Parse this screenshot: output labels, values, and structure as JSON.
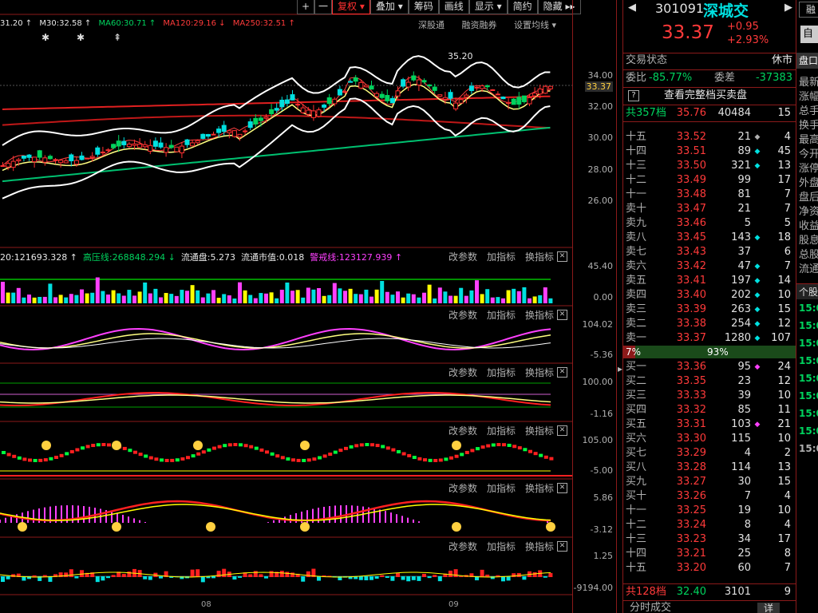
{
  "toolbar": {
    "plus": "+",
    "minus": "一",
    "items": [
      "复权",
      "叠加",
      "筹码",
      "画线",
      "显示",
      "简约",
      "隐藏"
    ],
    "arrows": [
      "▾",
      "▾",
      "",
      "",
      "▾",
      "",
      "▸▸"
    ]
  },
  "ma_row": {
    "ma_first": "31.20 ↑",
    "ma30": "M30:32.58 ↑",
    "ma60": "MA60:30.71 ↑",
    "ma120": "MA120:29.16 ↓",
    "ma250": "MA250:32.51 ↑"
  },
  "chart_links": [
    "深股通",
    "融资融券",
    "设置均线 ▾"
  ],
  "markers": [
    "✱",
    "✱",
    "⇞"
  ],
  "price_annot": "35.20",
  "price_axis": [
    "34.00",
    "33.37",
    "32.00",
    "30.00",
    "28.00",
    "26.00"
  ],
  "vol_header": {
    "a": "20:121693.328 ↑",
    "b": "高压线:268848.294 ↓",
    "c": "流通盘:5.273",
    "d": "流通市值:0.018",
    "e": "警戒线:123127.939 ↑"
  },
  "panel_buttons": [
    "改参数",
    "加指标",
    "换指标"
  ],
  "close_glyph": "✕",
  "panel_axes": [
    [
      "45.40",
      "0.00"
    ],
    [
      "104.02",
      "-5.36"
    ],
    [
      "100.00",
      "-1.16"
    ],
    [
      "105.00",
      "-5.00"
    ],
    [
      "5.86",
      "-3.12"
    ],
    [
      "1.25",
      "-9194.00"
    ]
  ],
  "x_axis": [
    "08",
    "09"
  ],
  "chart_data": {
    "type": "candlestick",
    "price_ylim": [
      26,
      36
    ],
    "current_price": 33.37,
    "high_annotation": 35.2,
    "x_ticks": [
      "08",
      "09"
    ],
    "moving_averages": {
      "M30": 32.58,
      "MA60": 30.71,
      "MA120": 29.16,
      "MA250": 32.51
    },
    "volume_indicator": {
      "高压线": 268848.294,
      "流通盘": 5.273,
      "流通市值": 0.018,
      "警戒线": 123127.939
    }
  },
  "quote": {
    "code": "301091",
    "name": "深城交",
    "price": "33.37",
    "change": "+0.95",
    "change_pct": "+2.93%",
    "btn_self": "自",
    "trade_status_label": "交易状态",
    "trade_status": "休市",
    "weibi_label": "委比",
    "weibi": "-85.77%",
    "weicha_label": "委差",
    "weicha": "-37383",
    "view_full": "查看完整档买卖盘",
    "help": "?",
    "top_total": {
      "label": "共357档",
      "price": "35.76",
      "vol": "40484",
      "cnt": "15"
    },
    "asks": [
      {
        "lab": "十五",
        "price": "33.52",
        "vol": "21",
        "mk": "◆",
        "mkc": "gray",
        "cnt": "4"
      },
      {
        "lab": "十四",
        "price": "33.51",
        "vol": "89",
        "mk": "◆",
        "mkc": "cyan",
        "cnt": "45"
      },
      {
        "lab": "十三",
        "price": "33.50",
        "vol": "321",
        "mk": "◆",
        "mkc": "cyan",
        "cnt": "13"
      },
      {
        "lab": "十二",
        "price": "33.49",
        "vol": "99",
        "mk": "",
        "mkc": "gray",
        "cnt": "17"
      },
      {
        "lab": "十一",
        "price": "33.48",
        "vol": "81",
        "mk": "",
        "mkc": "gray",
        "cnt": "7"
      },
      {
        "lab": "卖十",
        "price": "33.47",
        "vol": "21",
        "mk": "",
        "mkc": "gray",
        "cnt": "7"
      },
      {
        "lab": "卖九",
        "price": "33.46",
        "vol": "5",
        "mk": "",
        "mkc": "gray",
        "cnt": "5"
      },
      {
        "lab": "卖八",
        "price": "33.45",
        "vol": "143",
        "mk": "◆",
        "mkc": "cyan",
        "cnt": "18"
      },
      {
        "lab": "卖七",
        "price": "33.43",
        "vol": "37",
        "mk": "",
        "mkc": "gray",
        "cnt": "6"
      },
      {
        "lab": "卖六",
        "price": "33.42",
        "vol": "47",
        "mk": "◆",
        "mkc": "cyan",
        "cnt": "7"
      },
      {
        "lab": "卖五",
        "price": "33.41",
        "vol": "197",
        "mk": "◆",
        "mkc": "cyan",
        "cnt": "14"
      },
      {
        "lab": "卖四",
        "price": "33.40",
        "vol": "202",
        "mk": "◆",
        "mkc": "cyan",
        "cnt": "10"
      },
      {
        "lab": "卖三",
        "price": "33.39",
        "vol": "263",
        "mk": "◆",
        "mkc": "cyan",
        "cnt": "15"
      },
      {
        "lab": "卖二",
        "price": "33.38",
        "vol": "254",
        "mk": "◆",
        "mkc": "cyan",
        "cnt": "12"
      },
      {
        "lab": "卖一",
        "price": "33.37",
        "vol": "1280",
        "mk": "◆",
        "mkc": "cyan",
        "cnt": "107"
      }
    ],
    "ratio_left": "7%",
    "ratio_right": "93%",
    "ratio_left_frac": 0.07,
    "bids": [
      {
        "lab": "买一",
        "price": "33.36",
        "vol": "95",
        "mk": "◆",
        "mkc": "mag",
        "cnt": "24"
      },
      {
        "lab": "买二",
        "price": "33.35",
        "vol": "23",
        "mk": "",
        "mkc": "gray",
        "cnt": "12"
      },
      {
        "lab": "买三",
        "price": "33.33",
        "vol": "39",
        "mk": "",
        "mkc": "gray",
        "cnt": "10"
      },
      {
        "lab": "买四",
        "price": "33.32",
        "vol": "85",
        "mk": "",
        "mkc": "gray",
        "cnt": "11"
      },
      {
        "lab": "买五",
        "price": "33.31",
        "vol": "103",
        "mk": "◆",
        "mkc": "mag",
        "cnt": "21"
      },
      {
        "lab": "买六",
        "price": "33.30",
        "vol": "115",
        "mk": "",
        "mkc": "gray",
        "cnt": "10"
      },
      {
        "lab": "买七",
        "price": "33.29",
        "vol": "4",
        "mk": "",
        "mkc": "gray",
        "cnt": "2"
      },
      {
        "lab": "买八",
        "price": "33.28",
        "vol": "114",
        "mk": "",
        "mkc": "gray",
        "cnt": "13"
      },
      {
        "lab": "买九",
        "price": "33.27",
        "vol": "30",
        "mk": "",
        "mkc": "gray",
        "cnt": "15"
      },
      {
        "lab": "买十",
        "price": "33.26",
        "vol": "7",
        "mk": "",
        "mkc": "gray",
        "cnt": "4"
      },
      {
        "lab": "十一",
        "price": "33.25",
        "vol": "19",
        "mk": "",
        "mkc": "gray",
        "cnt": "10"
      },
      {
        "lab": "十二",
        "price": "33.24",
        "vol": "8",
        "mk": "",
        "mkc": "gray",
        "cnt": "4"
      },
      {
        "lab": "十三",
        "price": "33.23",
        "vol": "34",
        "mk": "",
        "mkc": "gray",
        "cnt": "17"
      },
      {
        "lab": "十四",
        "price": "33.21",
        "vol": "25",
        "mk": "",
        "mkc": "gray",
        "cnt": "8"
      },
      {
        "lab": "十五",
        "price": "33.20",
        "vol": "60",
        "mk": "",
        "mkc": "gray",
        "cnt": "7"
      }
    ],
    "bottom_total": {
      "label": "共128档",
      "price": "32.40",
      "vol": "3101",
      "cnt": "9"
    },
    "footer": "分时成交",
    "footer_btn": "详"
  },
  "far_panel": {
    "top": "融",
    "pan": "盘口",
    "items": [
      "最新",
      "涨幅",
      "总手",
      "换手",
      "最高",
      "今开",
      "涨停",
      "外盘",
      "盘后",
      "净资",
      "收益",
      "股息",
      "总股",
      "流通"
    ],
    "ge": "个股",
    "times": [
      "15:0",
      "15:0",
      "15:0",
      "15:0",
      "15:0",
      "15:0",
      "15:0",
      "15:0",
      "15:0"
    ]
  },
  "colors": {
    "up": "#ff3a3a",
    "down": "#00d35e",
    "accent": "#ffd040",
    "grid": "#8b1a1a"
  }
}
